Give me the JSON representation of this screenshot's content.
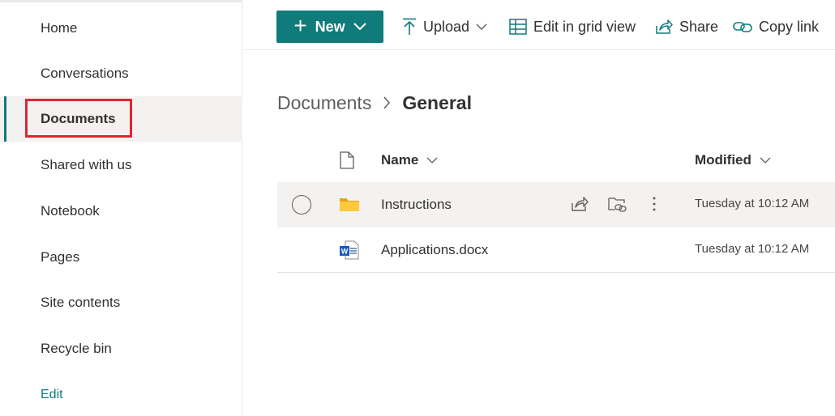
{
  "sidebar": {
    "items": [
      {
        "label": "Home"
      },
      {
        "label": "Conversations"
      },
      {
        "label": "Documents"
      },
      {
        "label": "Shared with us"
      },
      {
        "label": "Notebook"
      },
      {
        "label": "Pages"
      },
      {
        "label": "Site contents"
      },
      {
        "label": "Recycle bin"
      }
    ],
    "edit_label": "Edit",
    "active_item": "Documents",
    "highlight_color": "#e0262f"
  },
  "toolbar": {
    "new_label": "New",
    "upload_label": "Upload",
    "grid_label": "Edit in grid view",
    "share_label": "Share",
    "copy_link_label": "Copy link",
    "accent": "#0f7b7a"
  },
  "breadcrumb": {
    "parent": "Documents",
    "current": "General"
  },
  "list": {
    "columns": {
      "name": "Name",
      "modified": "Modified"
    },
    "rows": [
      {
        "name": "Instructions",
        "type": "folder-icon",
        "modified": "Tuesday at 10:12 AM"
      },
      {
        "name": "Applications.docx",
        "type": "word-doc-icon",
        "modified": "Tuesday at 10:12 AM"
      }
    ]
  }
}
